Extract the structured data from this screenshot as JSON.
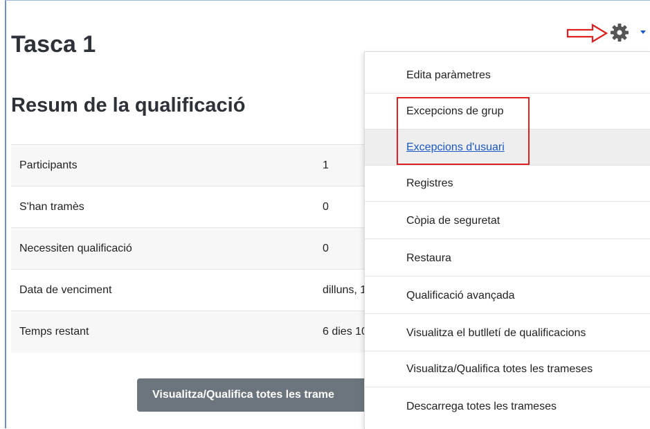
{
  "page": {
    "title": "Tasca 1",
    "section_title": "Resum de la qualificació"
  },
  "summary": {
    "rows": [
      {
        "label": "Participants",
        "value": "1"
      },
      {
        "label": "S'han tramès",
        "value": "0"
      },
      {
        "label": "Necessiten qualificació",
        "value": "0"
      },
      {
        "label": "Data de venciment",
        "value": "dilluns, 1"
      },
      {
        "label": "Temps restant",
        "value": "6 dies 10"
      }
    ]
  },
  "actions": {
    "grade_button_label": "Visualitza/Qualifica totes les trame"
  },
  "settings": {
    "icon": "gear-icon",
    "caret_icon": "caret-down-icon",
    "menu": [
      {
        "label": "Edita paràmetres"
      },
      {
        "label": "Excepcions de grup"
      },
      {
        "label": "Excepcions d'usuari"
      },
      {
        "label": "Registres"
      },
      {
        "label": "Còpia de seguretat"
      },
      {
        "label": "Restaura"
      },
      {
        "label": "Qualificació avançada"
      },
      {
        "label": "Visualitza el butlletí de qualificacions"
      },
      {
        "label": "Visualitza/Qualifica totes les trameses"
      },
      {
        "label": "Descarrega totes les trameses"
      }
    ]
  },
  "colors": {
    "annotation_red": "#e02020",
    "link_blue": "#1a58c8",
    "button_gray": "#6c757d",
    "gear_gray": "#555555"
  }
}
